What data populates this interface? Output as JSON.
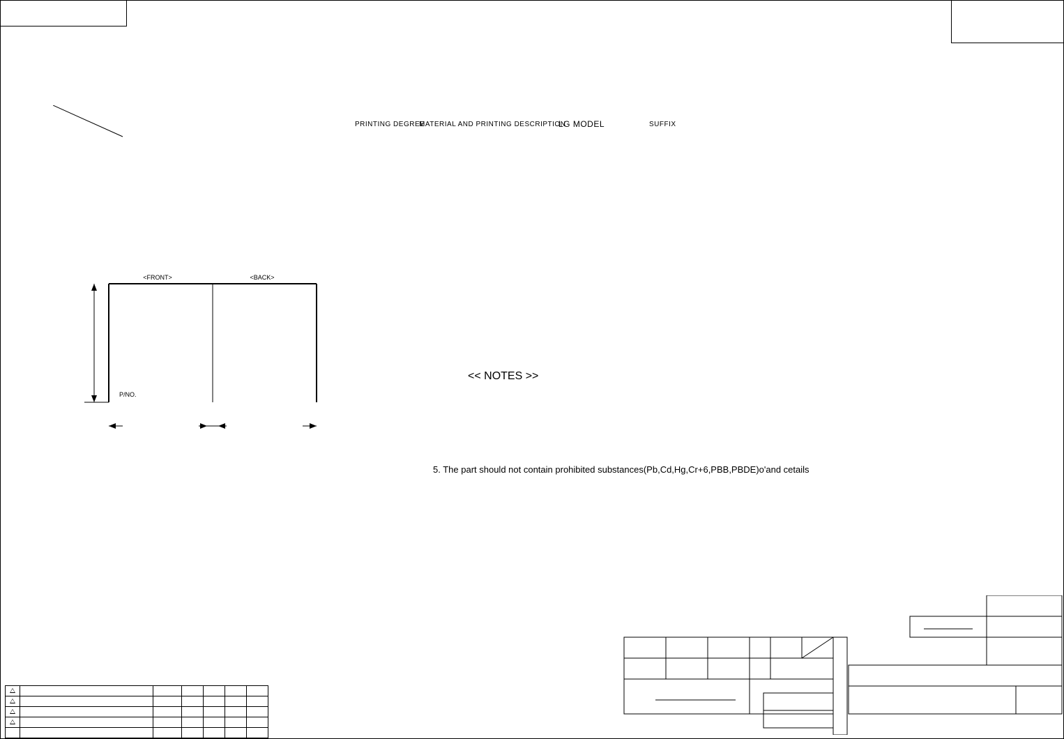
{
  "header": {
    "printing_degree": "PRINTING DEGREE",
    "material_desc": "MATERIAL AND PRINTING DESCRIPTION",
    "lg_model": "LG MODEL",
    "suffix": "SUFFIX"
  },
  "drawing": {
    "front_label": "<FRONT>",
    "back_label": "<BACK>",
    "pno_label": "P/NO."
  },
  "notes": {
    "title": "<< NOTES >>",
    "line5": "5. The part should not contain prohibited substances(Pb,Cd,Hg,Cr+6,PBB,PBDE)o'and cetails"
  }
}
